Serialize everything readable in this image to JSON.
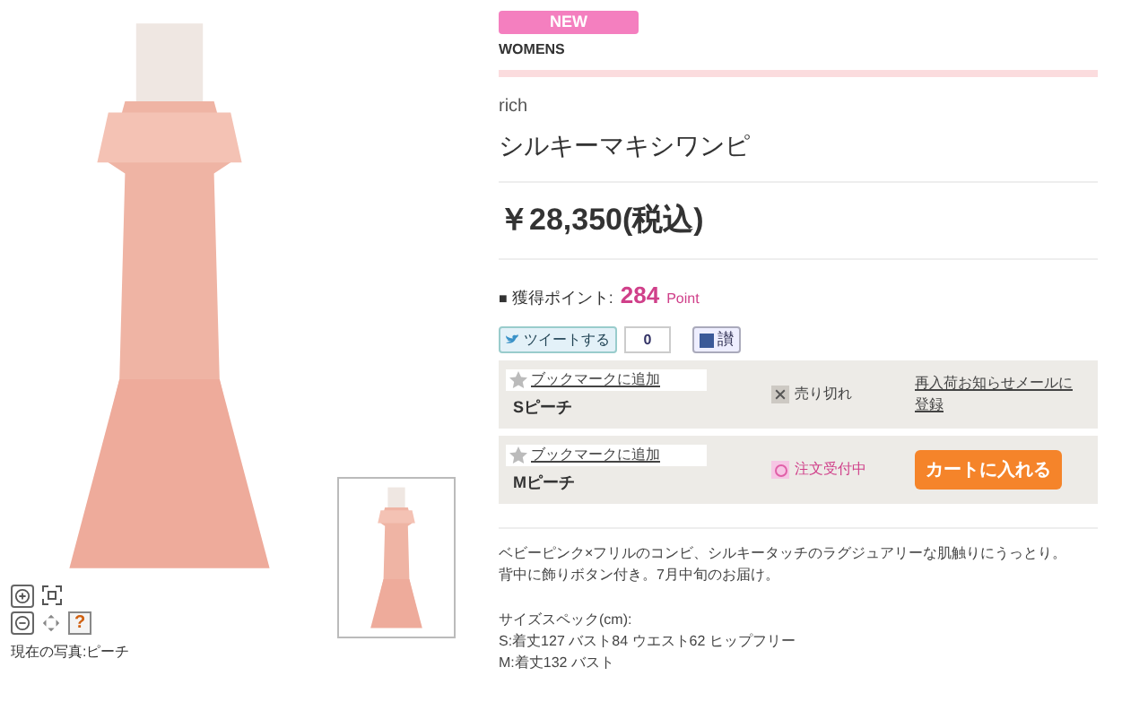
{
  "badge": "NEW",
  "category": "WOMENS",
  "brand": "rich",
  "title": "シルキーマキシワンピ",
  "price": "￥28,350(税込)",
  "points": {
    "bullet": "■",
    "label": "獲得ポイント:",
    "value": "284",
    "unit": "Point"
  },
  "social": {
    "tweet": "ツイートする",
    "count": "0",
    "like": "讃"
  },
  "variants": [
    {
      "bookmark": "ブックマークに追加",
      "name": "Sピーチ",
      "kind": "sold_out",
      "status": "売り切れ",
      "action": "再入荷お知らせメールに登録"
    },
    {
      "bookmark": "ブックマークに追加",
      "name": "Mピーチ",
      "kind": "available",
      "status": "注文受付中",
      "action": "カートに入れる"
    }
  ],
  "description": [
    "ベビーピンク×フリルのコンビ、シルキータッチのラグジュアリーな肌触りにうっとり。",
    "背中に飾りボタン付き。7月中旬のお届け。"
  ],
  "specs_title": "サイズスペック(cm):",
  "specs": [
    "S:着丈127 バスト84 ウエスト62 ヒップフリー",
    "M:着丈132 バスト"
  ],
  "viewer": {
    "help": "?",
    "caption": "現在の写真:ピーチ"
  }
}
